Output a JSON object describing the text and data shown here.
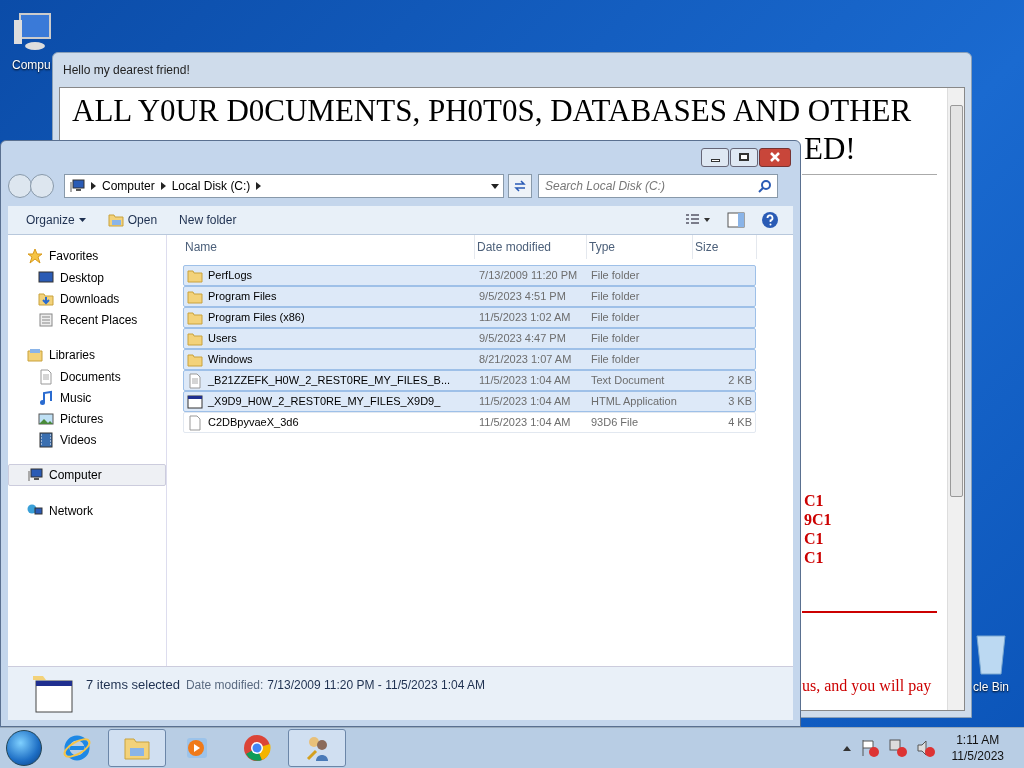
{
  "desktop_icons": [
    {
      "label": "Compu",
      "kind": "computer"
    },
    {
      "label": "cle Bin",
      "kind": "bin"
    }
  ],
  "note_window": {
    "title": "Hello my dearest friend!",
    "heading_line_1": "ALL Y0UR D0CUMENTS, PH0T0S, DATABASES AND OTHER",
    "heading_line_2": "ED!",
    "red_fragments": [
      "C1",
      "9C1",
      "C1",
      "C1"
    ],
    "bottom_text": "us, and you will pay"
  },
  "explorer": {
    "breadcrumb": [
      "Computer",
      "Local Disk (C:)"
    ],
    "search": {
      "placeholder": "Search Local Disk (C:)"
    },
    "toolbar": [
      {
        "label": "Organize",
        "kind": "menu"
      },
      {
        "label": "Open",
        "kind": "open"
      },
      {
        "label": "New folder",
        "kind": "plain"
      }
    ],
    "nav": [
      {
        "label": "Favorites",
        "kind": "star",
        "selected": false,
        "children": [
          {
            "label": "Desktop",
            "kind": "desktop",
            "selected": false
          },
          {
            "label": "Downloads",
            "kind": "downloads",
            "selected": false
          },
          {
            "label": "Recent Places",
            "kind": "recent",
            "selected": false
          }
        ]
      },
      {
        "label": "Libraries",
        "kind": "library",
        "selected": false,
        "children": [
          {
            "label": "Documents",
            "kind": "documents",
            "selected": false
          },
          {
            "label": "Music",
            "kind": "music",
            "selected": false
          },
          {
            "label": "Pictures",
            "kind": "pictures",
            "selected": false
          },
          {
            "label": "Videos",
            "kind": "videos",
            "selected": false
          }
        ]
      },
      {
        "label": "Computer",
        "kind": "computer",
        "selected": true
      },
      {
        "label": "Network",
        "kind": "network",
        "selected": false
      }
    ],
    "columns": [
      "Name",
      "Date modified",
      "Type",
      "Size"
    ],
    "rows": [
      {
        "name": "PerfLogs",
        "date": "7/13/2009 11:20 PM",
        "type": "File folder",
        "size": "",
        "kind": "folder",
        "selected": true
      },
      {
        "name": "Program Files",
        "date": "9/5/2023 4:51 PM",
        "type": "File folder",
        "size": "",
        "kind": "folder",
        "selected": true
      },
      {
        "name": "Program Files (x86)",
        "date": "11/5/2023 1:02 AM",
        "type": "File folder",
        "size": "",
        "kind": "folder",
        "selected": true
      },
      {
        "name": "Users",
        "date": "9/5/2023 4:47 PM",
        "type": "File folder",
        "size": "",
        "kind": "folder",
        "selected": true
      },
      {
        "name": "Windows",
        "date": "8/21/2023 1:07 AM",
        "type": "File folder",
        "size": "",
        "kind": "folder",
        "selected": true
      },
      {
        "name": "_B21ZZEFK_H0W_2_REST0RE_MY_FILES_B...",
        "date": "11/5/2023 1:04 AM",
        "type": "Text Document",
        "size": "2 KB",
        "kind": "text",
        "selected": true
      },
      {
        "name": "_X9D9_H0W_2_REST0RE_MY_FILES_X9D9_",
        "date": "11/5/2023 1:04 AM",
        "type": "HTML Application",
        "size": "3 KB",
        "kind": "app",
        "selected": true
      },
      {
        "name": "C2DBpyvaeX_3d6",
        "date": "11/5/2023 1:04 AM",
        "type": "93D6 File",
        "size": "4 KB",
        "kind": "file",
        "selected": false
      }
    ],
    "status": {
      "count": "7 items selected",
      "date_label": "Date modified:",
      "date_value": "7/13/2009 11:20 PM - 11/5/2023 1:04 AM"
    }
  },
  "taskbar": {
    "apps": [
      {
        "kind": "ie",
        "selected": false
      },
      {
        "kind": "explorer",
        "selected": true
      },
      {
        "kind": "media",
        "selected": false
      },
      {
        "kind": "chrome",
        "selected": false
      },
      {
        "kind": "users",
        "selected": true
      }
    ],
    "clock": {
      "time": "1:11 AM",
      "date": "11/5/2023"
    }
  }
}
